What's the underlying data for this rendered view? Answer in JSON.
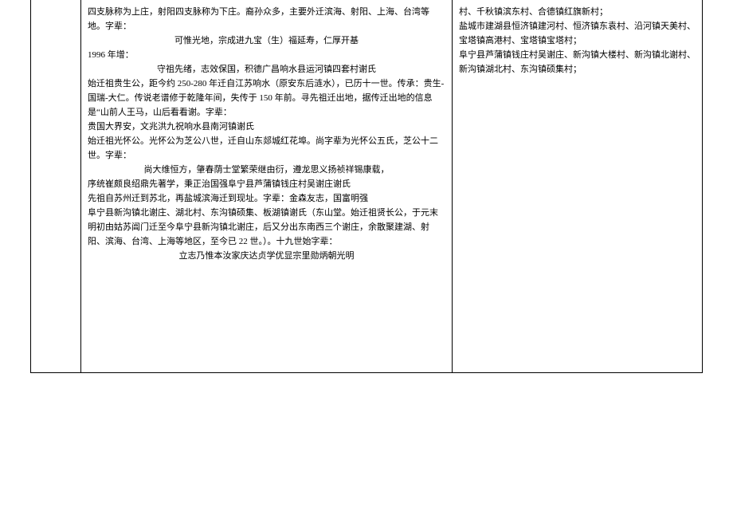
{
  "left": {
    "p1": "四支脉称为上庄，射阳四支脉称为下庄。裔孙众多，主要外迁滨海、射阳、上海、台湾等地。字辈：",
    "c1": "可惟光地，宗成进九宝（生）福延寿，仁厚开基",
    "p2": "1996 年增：",
    "c2": "守祖先绪，志效保国，积德广昌响水县运河镇四套村谢氏",
    "p3": "始迁祖贵生公，距今约 250-280 年迁自江苏响水（原安东后涟水），已历十一世。传承：贵生-国瑞-大仁。传说老谱修于乾隆年间，失传于 150 年前。寻先祖迁出地，据传迁出地的信息是“山前人王马，山后看看谢。字辈：",
    "p4": "贵国大界安，文兆洪九祝响水县南河镇谢氏",
    "p5": "始迁祖光怀公。光怀公为芝公八世，迁自山东郯城红花埠。尚字辈为光怀公五氏，芝公十二世。字辈：",
    "c3": "尚大维恒方，肇春荫士堂繁荣继由衍，遵龙思义扬祯祥锡康载，",
    "p6": "序统崔颇良绍鼎先著学，秉正治国强阜宁县芦蒲镇钱庄村吴谢庄谢氏",
    "p7": "先祖自苏州迁到苏北，再盐城滨海迁到现址。字辈：金森友志，国富明强",
    "p8": "阜宁县新沟镇北谢庄、湖北村、东沟镇硕集、板湖镇谢氏（东山堂。始迁祖贤长公，于元末明初由姑苏阊门迁至今阜宁县新沟镇北谢庄，后又分出东南西三个谢庄，余散聚建湖、射阳、滨海、台湾、上海等地区，至今已 22 世。）。十九世始字辈：",
    "c4": "立志乃惟本汝家庆达贞学优显宗里勋炳朝光明"
  },
  "right": {
    "p1": "村、千秋镇滨东村、合德镇红旗新村；",
    "p2": "盐城市建湖县恒济镇建河村、恒济镇东袁村、沿河镇天美村、宝塔镇高港村、宝塔镇宝塔村；",
    "p3": "阜宁县芦蒲镇钱庄村吴谢庄、新沟镇大楼村、新沟镇北谢村、新沟镇湖北村、东沟镇硕集村；"
  }
}
